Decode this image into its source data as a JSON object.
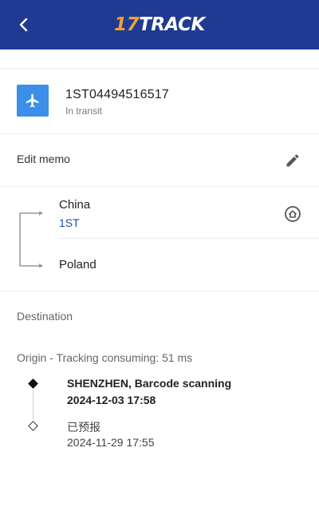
{
  "header": {
    "logo_number": "17",
    "logo_text": "TRACK",
    "back_icon": "chevron-left-icon"
  },
  "shipment": {
    "tracking_number": "1ST04494516517",
    "status": "In transit",
    "mode_icon": "airplane-icon"
  },
  "memo": {
    "label": "Edit memo",
    "icon": "pencil-icon"
  },
  "route": {
    "origin_country": "China",
    "origin_carrier": "1ST",
    "destination_country": "Poland",
    "home_icon": "home-icon"
  },
  "sections": {
    "destination_label": "Destination",
    "origin_label": "Origin - Tracking consuming: 51 ms"
  },
  "events": [
    {
      "title": "SHENZHEN, Barcode scanning",
      "time": "2024-12-03 17:58"
    },
    {
      "title": "已预报",
      "time": "2024-11-29 17:55"
    }
  ],
  "colors": {
    "header_bg": "#1f3a93",
    "logo_accent": "#f0a030",
    "plane_box": "#3b8fe8",
    "carrier_link": "#1f4aa8"
  }
}
